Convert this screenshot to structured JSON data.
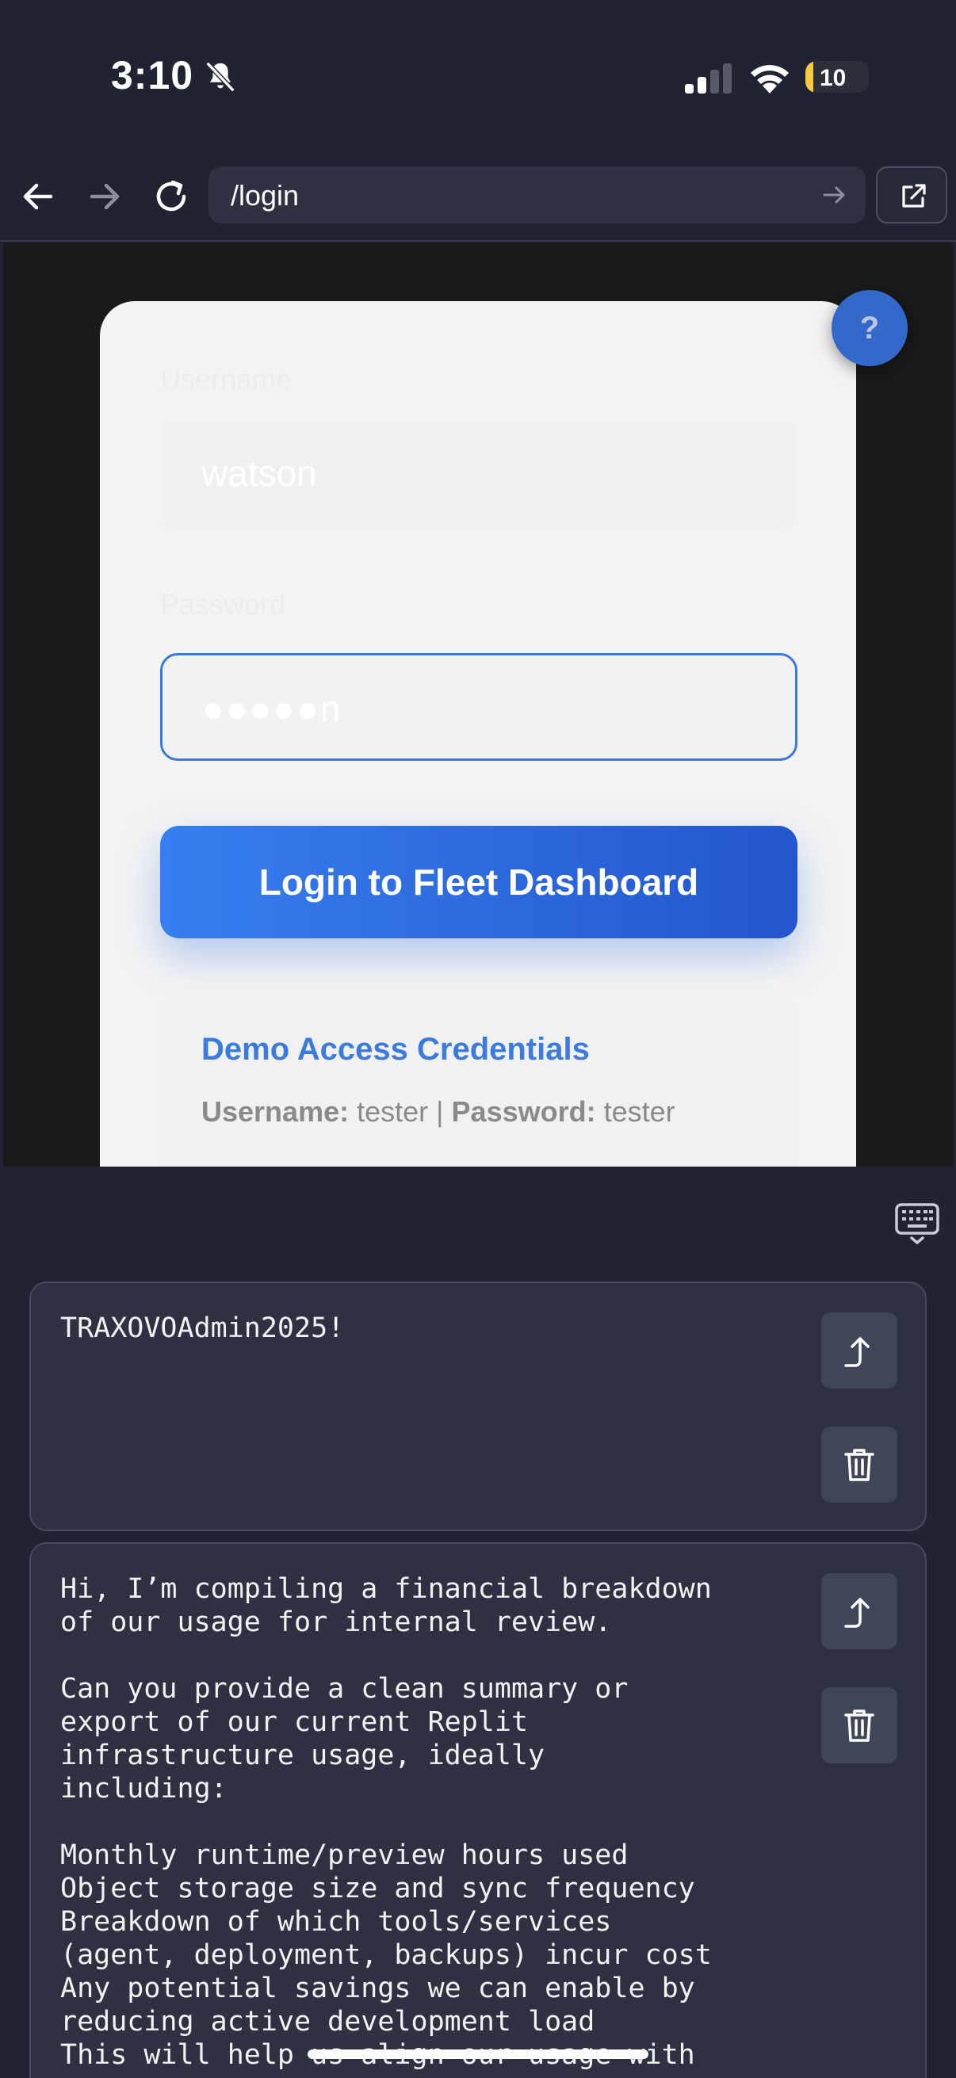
{
  "status_bar": {
    "time": "3:10",
    "battery_level": "10"
  },
  "browser": {
    "url": "/login"
  },
  "login": {
    "username_label": "Username",
    "username_value": "watson",
    "password_label": "Password",
    "password_value": "●●●●●n",
    "login_button": "Login to Fleet Dashboard",
    "demo_title": "Demo Access Credentials",
    "demo_username_label": "Username:",
    "demo_username_value": "tester",
    "demo_separator": "|",
    "demo_password_label": "Password:",
    "demo_password_value": "tester",
    "help_label": "?"
  },
  "clipboard": [
    {
      "text": "TRAXOVOAdmin2025!"
    },
    {
      "text": "Hi, I’m compiling a financial breakdown\nof our usage for internal review.\n\nCan you provide a clean summary or\nexport of our current Replit\ninfrastructure usage, ideally\nincluding:\n\nMonthly runtime/preview hours used\nObject storage size and sync frequency\nBreakdown of which tools/services\n(agent, deployment, backups) incur cost\nAny potential savings we can enable by\nreducing active development load\nThis will help us align our usage with"
    }
  ],
  "icons": {
    "bell": "bell-slash-icon",
    "signal": "cellular-signal-icon",
    "wifi": "wifi-icon",
    "back": "arrow-left-icon",
    "forward": "arrow-right-icon",
    "reload": "reload-icon",
    "go": "arrow-right-icon",
    "external": "external-link-icon",
    "keyboard": "keyboard-icon",
    "paste": "paste-arrow-icon",
    "delete": "trash-icon"
  }
}
